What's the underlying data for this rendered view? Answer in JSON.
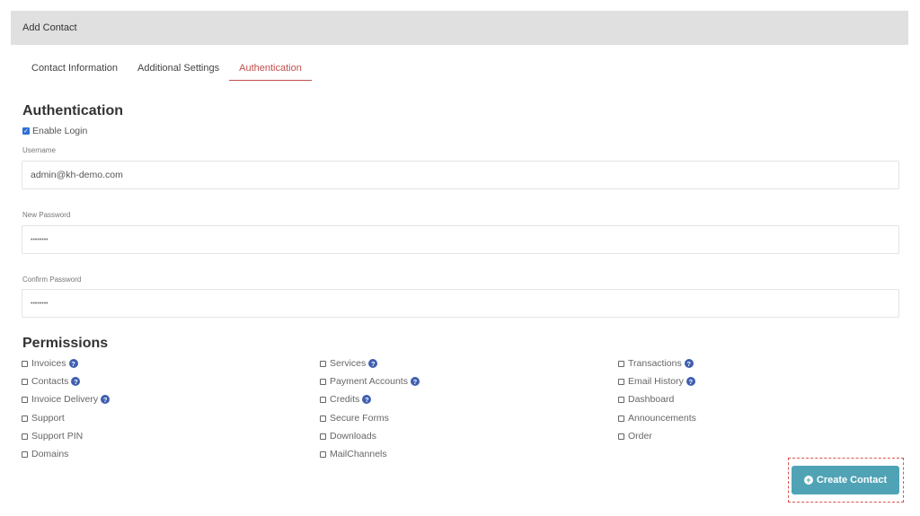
{
  "panel": {
    "title": "Add Contact"
  },
  "tabs": [
    {
      "label": "Contact Information",
      "active": false
    },
    {
      "label": "Additional Settings",
      "active": false
    },
    {
      "label": "Authentication",
      "active": true
    }
  ],
  "authentication": {
    "title": "Authentication",
    "enable_login": {
      "label": "Enable Login",
      "checked": true
    },
    "username": {
      "label": "Username",
      "value": "admin@kh-demo.com"
    },
    "new_password": {
      "label": "New Password",
      "value": "••••••••"
    },
    "confirm_password": {
      "label": "Confirm Password",
      "value": "••••••••"
    }
  },
  "permissions": {
    "title": "Permissions",
    "columns": [
      [
        {
          "label": "Invoices",
          "help": true
        },
        {
          "label": "Contacts",
          "help": true
        },
        {
          "label": "Invoice Delivery",
          "help": true
        },
        {
          "label": "Support",
          "help": false
        },
        {
          "label": "Support PIN",
          "help": false
        },
        {
          "label": "Domains",
          "help": false
        }
      ],
      [
        {
          "label": "Services",
          "help": true
        },
        {
          "label": "Payment Accounts",
          "help": true
        },
        {
          "label": "Credits",
          "help": true
        },
        {
          "label": "Secure Forms",
          "help": false
        },
        {
          "label": "Downloads",
          "help": false
        },
        {
          "label": "MailChannels",
          "help": false
        }
      ],
      [
        {
          "label": "Transactions",
          "help": true
        },
        {
          "label": "Email History",
          "help": true
        },
        {
          "label": "Dashboard",
          "help": false
        },
        {
          "label": "Announcements",
          "help": false
        },
        {
          "label": "Order",
          "help": false
        }
      ]
    ]
  },
  "actions": {
    "create_label": "Create Contact"
  },
  "colors": {
    "accent_tab": "#c0504d",
    "button": "#4fa3b5",
    "help_icon": "#3f5fb0",
    "checkbox_checked": "#2f6fd6"
  }
}
